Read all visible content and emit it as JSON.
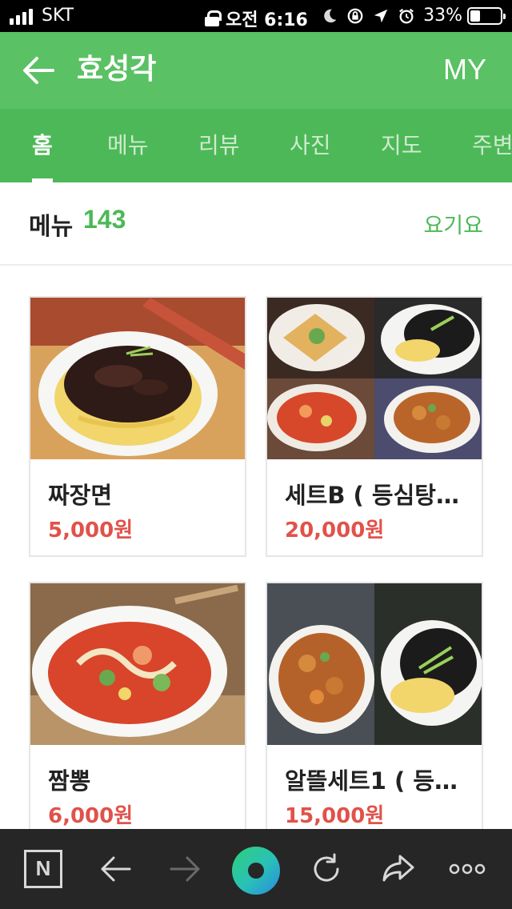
{
  "status_bar": {
    "carrier": "SKT",
    "time": "오전 6:16",
    "battery": "33%",
    "battery_level": 0.33
  },
  "header": {
    "title": "효성각",
    "my_label": "MY"
  },
  "tabs": [
    {
      "label": "홈",
      "active": true
    },
    {
      "label": "메뉴",
      "active": false
    },
    {
      "label": "리뷰",
      "active": false
    },
    {
      "label": "사진",
      "active": false
    },
    {
      "label": "지도",
      "active": false
    },
    {
      "label": "주변",
      "active": false
    }
  ],
  "menu": {
    "label": "메뉴",
    "count": "143",
    "partner_link": "요기요"
  },
  "items": [
    {
      "name": "짜장면",
      "price": "5,000원"
    },
    {
      "name": "세트B ( 등심탕…",
      "price": "20,000원"
    },
    {
      "name": "짬뽕",
      "price": "6,000원"
    },
    {
      "name": "알뜰세트1 ( 등…",
      "price": "15,000원"
    }
  ],
  "toolbar": {
    "n_label": "N"
  },
  "icons": {
    "back": "arrow-left-icon",
    "n": "naver-n-icon",
    "nav_back": "arrow-left-icon",
    "nav_forward": "arrow-right-icon",
    "home": "green-dot-icon",
    "refresh": "refresh-icon",
    "share": "share-icon",
    "more": "more-dots-icon"
  },
  "colors": {
    "brand_green": "#5ac164",
    "tab_green": "#4db857",
    "price_red": "#e1524a",
    "toolbar_bg": "#262626"
  }
}
